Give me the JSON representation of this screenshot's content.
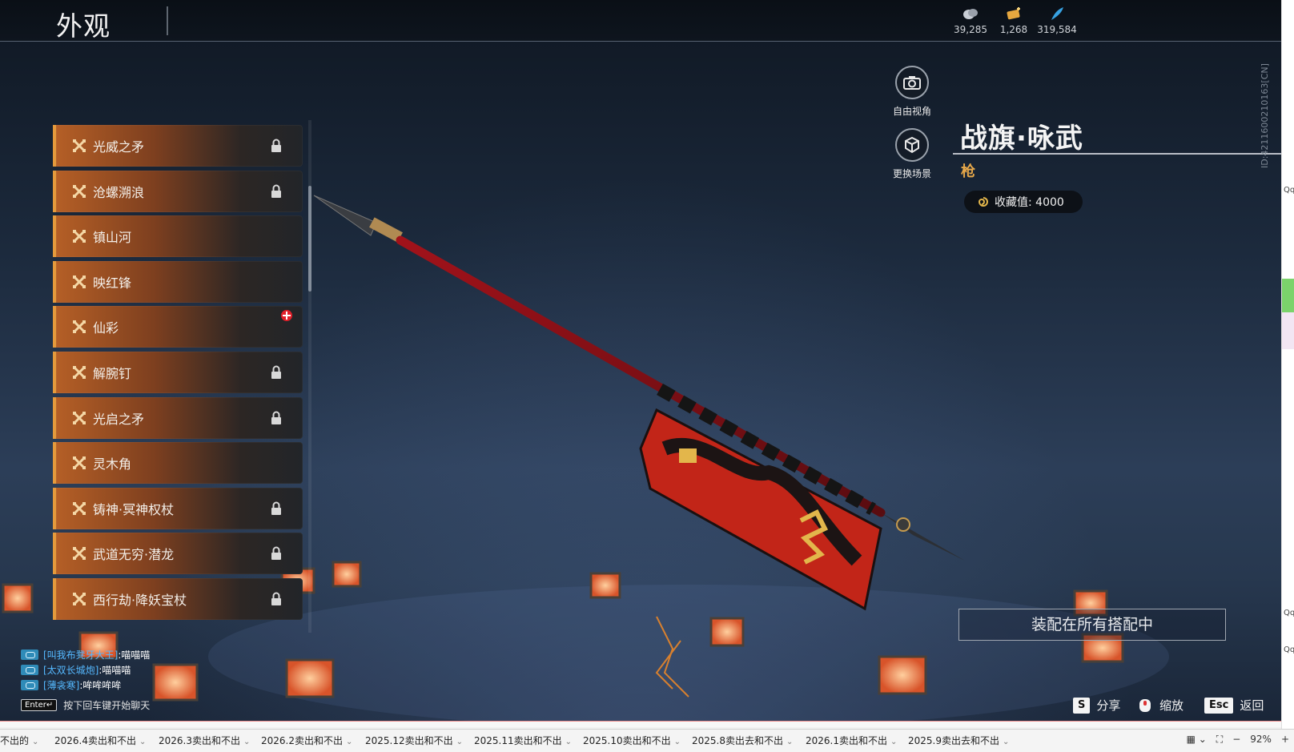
{
  "header": {
    "title": "外观",
    "currencies": [
      {
        "icon": "silver-coin-icon",
        "value": "39,285"
      },
      {
        "icon": "gold-ticket-icon",
        "value": "1,268"
      },
      {
        "icon": "blue-feather-icon",
        "value": "319,584"
      }
    ]
  },
  "list": {
    "items": [
      {
        "label": "光威之矛",
        "locked": true,
        "new": false
      },
      {
        "label": "沧螺溯浪",
        "locked": true,
        "new": false
      },
      {
        "label": "镇山河",
        "locked": false,
        "new": false
      },
      {
        "label": "映红锋",
        "locked": false,
        "new": false
      },
      {
        "label": "仙彩",
        "locked": false,
        "new": true
      },
      {
        "label": "解腕钉",
        "locked": true,
        "new": false
      },
      {
        "label": "光启之矛",
        "locked": true,
        "new": false
      },
      {
        "label": "灵木角",
        "locked": false,
        "new": false
      },
      {
        "label": "铸神·冥神权杖",
        "locked": true,
        "new": false
      },
      {
        "label": "武道无穷·潜龙",
        "locked": true,
        "new": false
      },
      {
        "label": "西行劫·降妖宝杖",
        "locked": true,
        "new": false
      }
    ]
  },
  "side_buttons": {
    "free_view": "自由视角",
    "change_scene": "更换场景"
  },
  "item_info": {
    "name": "战旗·咏武",
    "type": "枪",
    "collect_value": "收藏值: 4000",
    "id_text": "ID:4211600210163[CN]"
  },
  "equip_button": "装配在所有搭配中",
  "chat": {
    "lines": [
      {
        "channel": "[叫我布凳牙大王]",
        "message": ":喵喵喵"
      },
      {
        "channel": "[太双长城炮]",
        "message": ":喵喵喵"
      },
      {
        "channel": "[薄衾寒]",
        "message": ":哞哞哞哞"
      }
    ],
    "enter_key": "Enter↵",
    "hint": "按下回车键开始聊天"
  },
  "hotkeys": [
    {
      "key": "S",
      "label": "分享"
    },
    {
      "key": "",
      "label": "缩放"
    },
    {
      "key": "Esc",
      "label": "返回"
    }
  ],
  "sheet_tabs": [
    "不出的",
    "2026.4卖出和不出",
    "2026.3卖出和不出",
    "2026.2卖出和不出",
    "2025.12卖出和不出",
    "2025.11卖出和不出",
    "2025.10卖出和不出",
    "2025.8卖出去和不出",
    "2026.1卖出和不出",
    "2025.9卖出去和不出"
  ],
  "zoom_level": "92%",
  "right_strip_labels": [
    "Qq",
    "Qq",
    "Qq"
  ],
  "colors": {
    "accent_orange": "#e59a3c",
    "type_gold": "#e7a84a",
    "chat_channel": "#55b9ff"
  }
}
